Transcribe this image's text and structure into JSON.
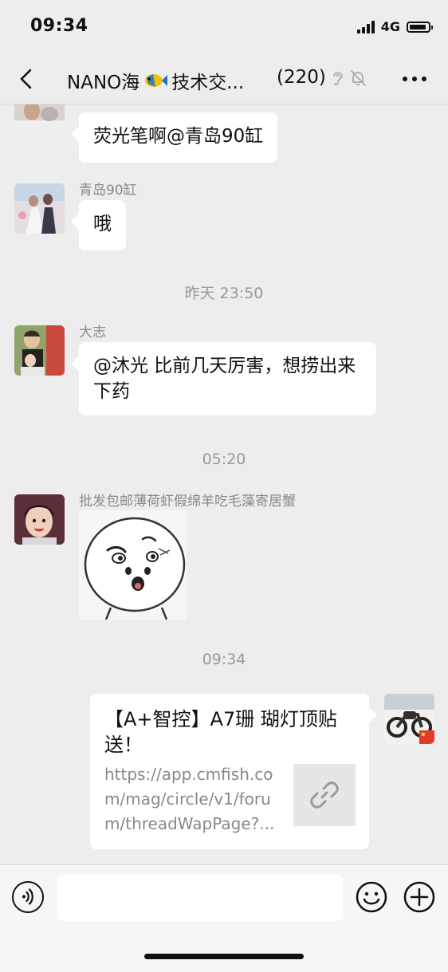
{
  "status_bar": {
    "time": "09:34",
    "network": "4G"
  },
  "nav": {
    "title_left": "NANO海",
    "title_right": "技术交...",
    "member_count": "(220)"
  },
  "messages": [
    {
      "type": "text",
      "sender": "",
      "text": "荧光笔啊@青岛90缸"
    },
    {
      "type": "text",
      "sender": "青岛90缸",
      "text": "哦"
    },
    {
      "type": "time",
      "text": "昨天 23:50"
    },
    {
      "type": "text",
      "sender": "大志",
      "text": "@沐光 比前几天厉害，想捞出来下药"
    },
    {
      "type": "time",
      "text": "05:20"
    },
    {
      "type": "sticker",
      "sender": "批发包邮薄荷虾假绵羊吃毛藻寄居蟹"
    },
    {
      "type": "time",
      "text": "09:34"
    },
    {
      "type": "link",
      "title": "【A+智控】A7珊 瑚灯顶贴送！",
      "url": "https://app.cmfish.com/mag/circle/v1/forum/threadWapPage?..."
    }
  ],
  "input": {
    "placeholder": ""
  },
  "colors": {
    "background": "#ededed",
    "bubble": "#ffffff",
    "muted_text": "#888888"
  }
}
